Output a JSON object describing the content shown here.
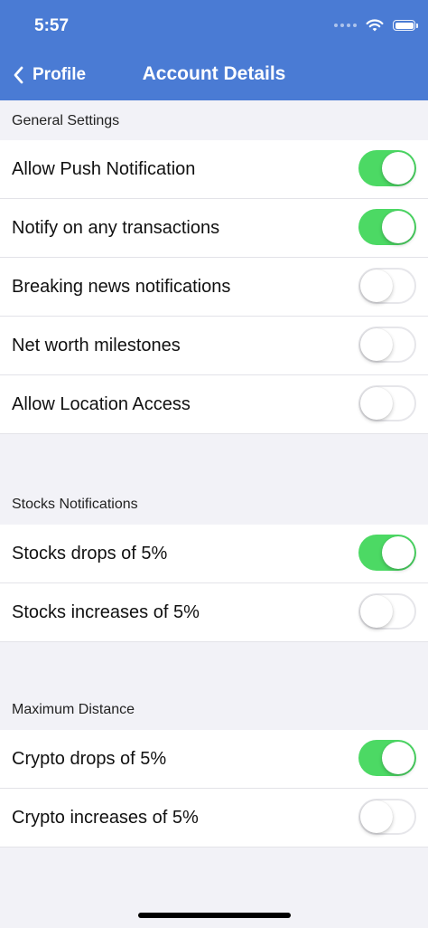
{
  "status_bar": {
    "time": "5:57"
  },
  "nav": {
    "back_label": "Profile",
    "title": "Account Details"
  },
  "colors": {
    "nav_bar": "#4a7bd4",
    "toggle_on": "#4cd964",
    "background": "#f2f2f7"
  },
  "sections": [
    {
      "title": "General Settings",
      "rows": [
        {
          "label": "Allow Push Notification",
          "on": true
        },
        {
          "label": "Notify on any transactions",
          "on": true
        },
        {
          "label": "Breaking news notifications",
          "on": false
        },
        {
          "label": "Net worth milestones",
          "on": false
        },
        {
          "label": "Allow Location Access",
          "on": false
        }
      ]
    },
    {
      "title": "Stocks Notifications",
      "rows": [
        {
          "label": "Stocks drops of 5%",
          "on": true
        },
        {
          "label": "Stocks increases of 5%",
          "on": false
        }
      ]
    },
    {
      "title": "Maximum Distance",
      "rows": [
        {
          "label": "Crypto drops of 5%",
          "on": true
        },
        {
          "label": "Crypto increases of 5%",
          "on": false
        }
      ]
    }
  ]
}
